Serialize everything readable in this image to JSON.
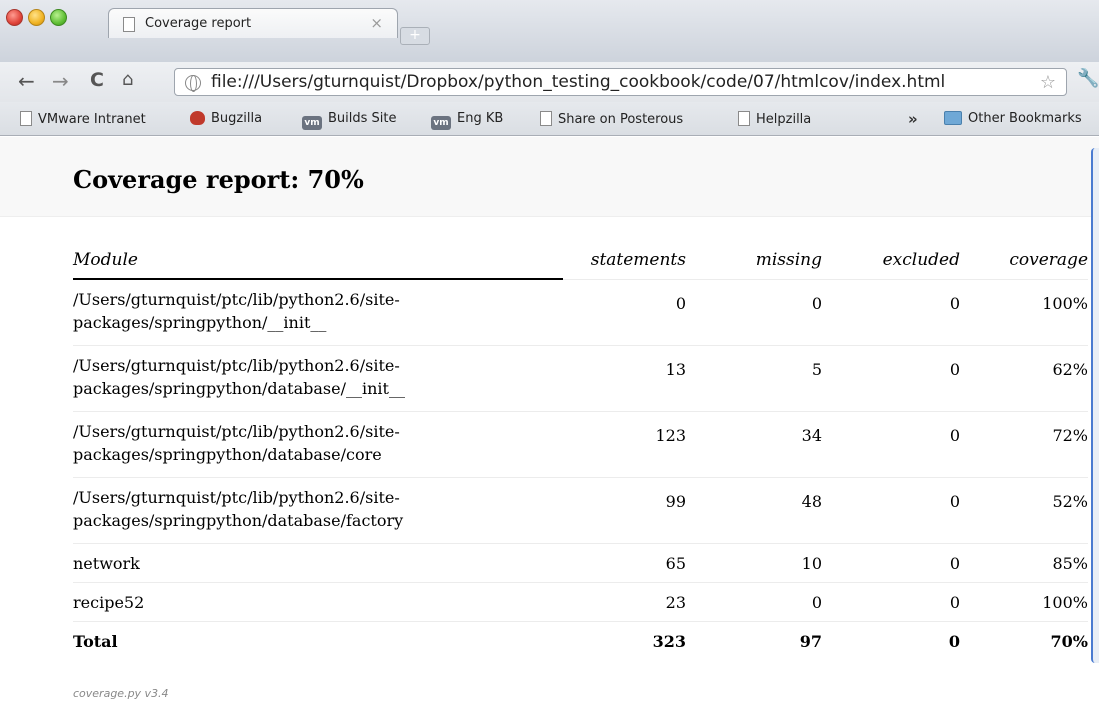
{
  "browser": {
    "tab_title": "Coverage report",
    "tab_close_glyph": "×",
    "new_tab_glyph": "+",
    "url": "file:///Users/gturnquist/Dropbox/python_testing_cookbook/code/07/htmlcov/index.html",
    "nav": {
      "back": "←",
      "forward": "→",
      "reload": "C",
      "home": "⌂",
      "star": "☆",
      "wrench": "🔧"
    },
    "bookmarks": [
      {
        "label": "VMware Intranet",
        "icon": "page-icon"
      },
      {
        "label": "Bugzilla",
        "icon": "bug-icon"
      },
      {
        "label": "Builds Site",
        "icon": "vm-icon"
      },
      {
        "label": "Eng KB",
        "icon": "vm-icon"
      },
      {
        "label": "Share on Posterous",
        "icon": "page-icon"
      },
      {
        "label": "Helpzilla",
        "icon": "page-icon"
      }
    ],
    "more_glyph": "»",
    "other_bookmarks": "Other Bookmarks",
    "vm_icon_text": "vm"
  },
  "report": {
    "title": "Coverage report: 70%",
    "columns": {
      "module": "Module",
      "statements": "statements",
      "missing": "missing",
      "excluded": "excluded",
      "coverage": "coverage"
    },
    "rows": [
      {
        "module_line1": "/Users/gturnquist/ptc/lib/python2.6/site-",
        "module_line2": "packages/springpython/__init__",
        "statements": "0",
        "missing": "0",
        "excluded": "0",
        "coverage": "100%"
      },
      {
        "module_line1": "/Users/gturnquist/ptc/lib/python2.6/site-",
        "module_line2": "packages/springpython/database/__init__",
        "statements": "13",
        "missing": "5",
        "excluded": "0",
        "coverage": "62%"
      },
      {
        "module_line1": "/Users/gturnquist/ptc/lib/python2.6/site-",
        "module_line2": "packages/springpython/database/core",
        "statements": "123",
        "missing": "34",
        "excluded": "0",
        "coverage": "72%"
      },
      {
        "module_line1": "/Users/gturnquist/ptc/lib/python2.6/site-",
        "module_line2": "packages/springpython/database/factory",
        "statements": "99",
        "missing": "48",
        "excluded": "0",
        "coverage": "52%"
      },
      {
        "module_line1": "network",
        "statements": "65",
        "missing": "10",
        "excluded": "0",
        "coverage": "85%"
      },
      {
        "module_line1": "recipe52",
        "statements": "23",
        "missing": "0",
        "excluded": "0",
        "coverage": "100%"
      }
    ],
    "total": {
      "label": "Total",
      "statements": "323",
      "missing": "97",
      "excluded": "0",
      "coverage": "70%"
    },
    "footer": "coverage.py v3.4"
  }
}
